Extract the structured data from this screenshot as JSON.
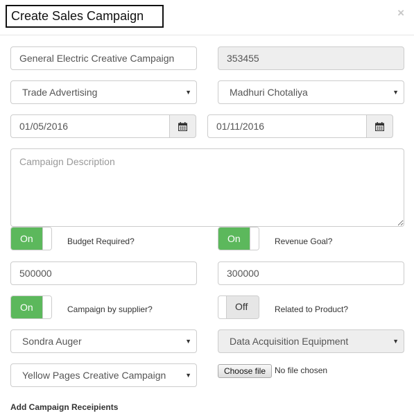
{
  "modal": {
    "title": "Create Sales Campaign",
    "close_label": "×"
  },
  "fields": {
    "campaign_name": "General Electric Creative Campaign",
    "campaign_id": "353455",
    "campaign_type": "Trade Advertising",
    "owner": "Madhuri Chotaliya",
    "start_date": "01/05/2016",
    "end_date": "01/11/2016",
    "description_placeholder": "Campaign Description",
    "budget_amount": "500000",
    "revenue_amount": "300000",
    "supplier": "Sondra Auger",
    "product": "Data Acquisition Equipment",
    "related_campaign": "Yellow Pages Creative Campaign"
  },
  "toggles": {
    "budget_required": {
      "state": "On",
      "label": "Budget Required?"
    },
    "revenue_goal": {
      "state": "On",
      "label": "Revenue Goal?"
    },
    "campaign_by_supplier": {
      "state": "On",
      "label": "Campaign by supplier?"
    },
    "related_to_product": {
      "state": "Off",
      "label": "Related to Product?"
    }
  },
  "file_upload": {
    "button_label": "Choose file",
    "status": "No file chosen"
  },
  "recipients": {
    "title": "Add Campaign Receipients"
  },
  "icons": {
    "calendar": "calendar-icon",
    "caret": "caret-down-icon",
    "close": "close-icon"
  },
  "colors": {
    "toggle_on": "#5cb85c",
    "readonly_bg": "#eeeeee",
    "border": "#cccccc"
  }
}
